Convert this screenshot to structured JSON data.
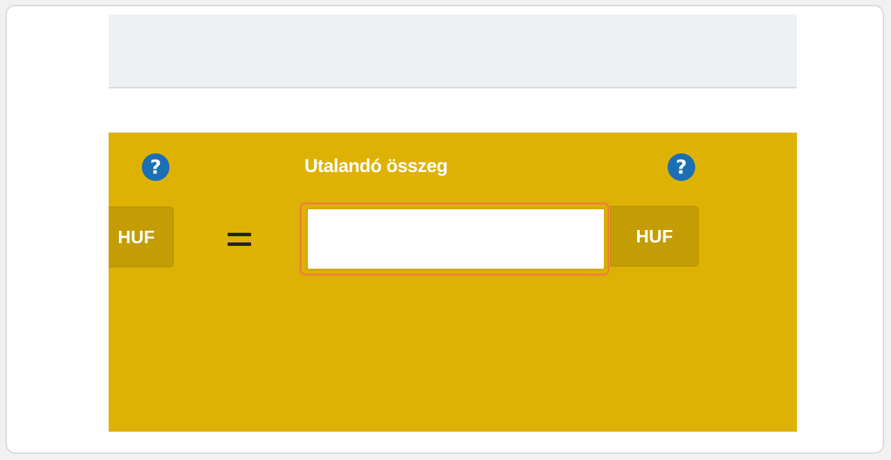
{
  "converter": {
    "target_label": "Utalandó összeg",
    "equals_sign": "=",
    "source_currency": "HUF",
    "target_currency": "HUF",
    "target_amount_value": "",
    "help_icon_glyph": "?"
  },
  "colors": {
    "panel_background": "#ddb204",
    "currency_addon": "#c49c04",
    "help_icon": "#1c6fb5",
    "focus_ring": "#f0803a",
    "top_bar": "#eef1f4"
  },
  "icons": {
    "help": "question-circle-icon"
  }
}
